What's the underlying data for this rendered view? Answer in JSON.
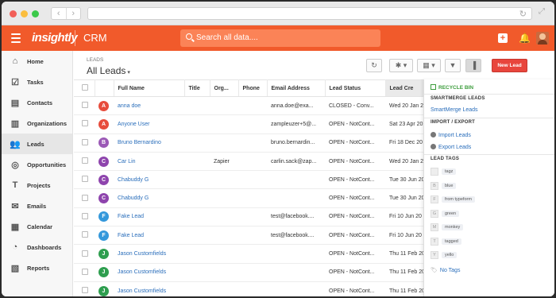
{
  "browser": {
    "back_icon": "chevron-left-icon",
    "forward_icon": "chevron-right-icon",
    "reload_icon": "reload-icon"
  },
  "header": {
    "logo": "insightly",
    "app": "CRM",
    "search_placeholder": "Search all data....",
    "brand_color": "#f15a2b"
  },
  "sidebar": {
    "items": [
      {
        "label": "Home",
        "icon": "home-icon",
        "glyph": "⌂"
      },
      {
        "label": "Tasks",
        "icon": "check-icon",
        "glyph": "☑"
      },
      {
        "label": "Contacts",
        "icon": "contacts-icon",
        "glyph": "▤"
      },
      {
        "label": "Organizations",
        "icon": "building-icon",
        "glyph": "▥"
      },
      {
        "label": "Leads",
        "icon": "people-icon",
        "glyph": "👥"
      },
      {
        "label": "Opportunities",
        "icon": "target-icon",
        "glyph": "◎"
      },
      {
        "label": "Projects",
        "icon": "hammer-icon",
        "glyph": "T"
      },
      {
        "label": "Emails",
        "icon": "envelope-icon",
        "glyph": "✉"
      },
      {
        "label": "Calendar",
        "icon": "calendar-icon",
        "glyph": "▦"
      },
      {
        "label": "Dashboards",
        "icon": "dashboard-icon",
        "glyph": "◔"
      },
      {
        "label": "Reports",
        "icon": "reports-icon",
        "glyph": "▧"
      }
    ],
    "active": "Leads"
  },
  "main": {
    "section_label": "LEADS",
    "title": "All Leads",
    "toolbar": {
      "refresh_glyph": "↻",
      "settings_glyph": "✱ ▾",
      "columns_glyph": "▦ ▾",
      "filter_glyph": "▼",
      "split_glyph": "▐"
    },
    "new_lead_label": "New Lead",
    "columns": [
      "Full Name",
      "Title",
      "Org...",
      "Phone",
      "Email Address",
      "Lead Status",
      "Lead Cre"
    ],
    "rows": [
      {
        "initial": "A",
        "color": "#e74c3c",
        "name": "anna doe",
        "title": "",
        "org": "",
        "phone": "",
        "email": "anna.doe@exa...",
        "status": "CLOSED - Conv...",
        "created": "Wed 20 Jan 20"
      },
      {
        "initial": "A",
        "color": "#e74c3c",
        "name": "Anyone User",
        "title": "",
        "org": "",
        "phone": "",
        "email": "zampleuzer+5@...",
        "status": "OPEN - NotCont...",
        "created": "Sat 23 Apr 20"
      },
      {
        "initial": "B",
        "color": "#9b59b6",
        "name": "Bruno Bernardino",
        "title": "",
        "org": "",
        "phone": "",
        "email": "bruno.bernardin...",
        "status": "OPEN - NotCont...",
        "created": "Fri 18 Dec 20"
      },
      {
        "initial": "C",
        "color": "#8e44ad",
        "name": "Car Lin",
        "title": "",
        "org": "Zapier",
        "phone": "",
        "email": "carlin.sack@zap...",
        "status": "OPEN - NotCont...",
        "created": "Wed 20 Jan 20"
      },
      {
        "initial": "C",
        "color": "#8e44ad",
        "name": "Chabuddy G",
        "title": "",
        "org": "",
        "phone": "",
        "email": "",
        "status": "OPEN - NotCont...",
        "created": "Tue 30 Jun 20"
      },
      {
        "initial": "C",
        "color": "#8e44ad",
        "name": "Chabuddy G",
        "title": "",
        "org": "",
        "phone": "",
        "email": "",
        "status": "OPEN - NotCont...",
        "created": "Tue 30 Jun 20"
      },
      {
        "initial": "F",
        "color": "#3498db",
        "name": "Fake Lead",
        "title": "",
        "org": "",
        "phone": "",
        "email": "test@facebook....",
        "status": "OPEN - NotCont...",
        "created": "Fri 10 Jun 20"
      },
      {
        "initial": "F",
        "color": "#3498db",
        "name": "Fake Lead",
        "title": "",
        "org": "",
        "phone": "",
        "email": "test@facebook....",
        "status": "OPEN - NotCont...",
        "created": "Fri 10 Jun 20"
      },
      {
        "initial": "J",
        "color": "#2e9e4f",
        "name": "Jason Customfields",
        "title": "",
        "org": "",
        "phone": "",
        "email": "",
        "status": "OPEN - NotCont...",
        "created": "Thu 11 Feb 20"
      },
      {
        "initial": "J",
        "color": "#2e9e4f",
        "name": "Jason Customfields",
        "title": "",
        "org": "",
        "phone": "",
        "email": "",
        "status": "OPEN - NotCont...",
        "created": "Thu 11 Feb 20"
      },
      {
        "initial": "J",
        "color": "#2e9e4f",
        "name": "Jason Customfields",
        "title": "",
        "org": "",
        "phone": "",
        "email": "",
        "status": "OPEN - NotCont...",
        "created": "Thu 11 Feb 20"
      }
    ]
  },
  "panel": {
    "recycle_bin": "RECYCLE BIN",
    "smartmerge_header": "SMARTMERGE LEADS",
    "smartmerge_link": "SmartMerge Leads",
    "import_export_header": "IMPORT / EXPORT",
    "import_link": "Import Leads",
    "export_link": "Export Leads",
    "tags_header": "LEAD TAGS",
    "tags": [
      {
        "letter": "",
        "name": "tagz"
      },
      {
        "letter": "B",
        "name": "blue"
      },
      {
        "letter": "F",
        "name": "from typeform"
      },
      {
        "letter": "G",
        "name": "green"
      },
      {
        "letter": "M",
        "name": "monkey"
      },
      {
        "letter": "T",
        "name": "tagged"
      },
      {
        "letter": "Y",
        "name": "yello"
      }
    ],
    "no_tags": "No Tags"
  }
}
